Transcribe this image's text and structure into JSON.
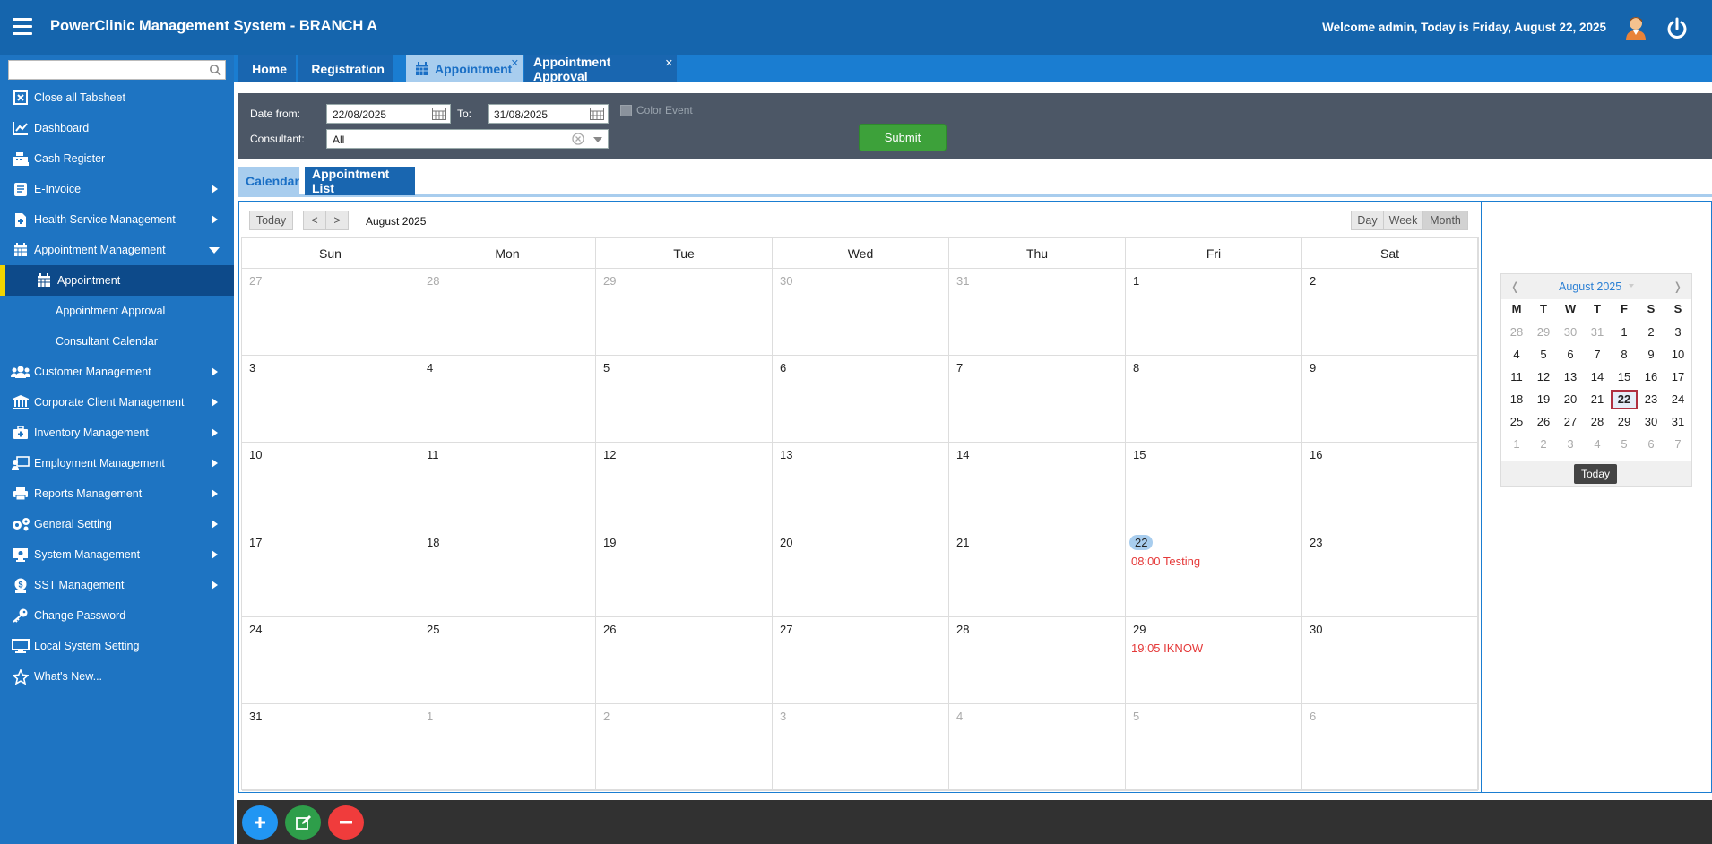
{
  "header": {
    "title": "PowerClinic Management System - BRANCH A",
    "welcome": "Welcome admin, Today is Friday, August 22, 2025"
  },
  "sidebar": {
    "search": {
      "placeholder": ""
    },
    "items": [
      {
        "label": "Close all Tabsheet",
        "icon": "close-box-icon",
        "submenu": false
      },
      {
        "label": "Dashboard",
        "icon": "chart-icon",
        "submenu": false
      },
      {
        "label": "Cash Register",
        "icon": "cash-register-icon",
        "submenu": false
      },
      {
        "label": "E-Invoice",
        "icon": "invoice-icon",
        "submenu": true
      },
      {
        "label": "Health Service Management",
        "icon": "file-plus-icon",
        "submenu": true
      },
      {
        "label": "Appointment Management",
        "icon": "calendar-icon",
        "submenu": true,
        "expanded": true
      },
      {
        "label": "Appointment",
        "icon": "calendar-icon",
        "active": true
      },
      {
        "label": "Appointment Approval",
        "sub": true
      },
      {
        "label": "Consultant Calendar",
        "sub": true
      },
      {
        "label": "Customer Management",
        "icon": "users-icon",
        "submenu": true
      },
      {
        "label": "Corporate Client Management",
        "icon": "bank-icon",
        "submenu": true
      },
      {
        "label": "Inventory Management",
        "icon": "medkit-icon",
        "submenu": true
      },
      {
        "label": "Employment Management",
        "icon": "employee-icon",
        "submenu": true
      },
      {
        "label": "Reports Management",
        "icon": "printer-icon",
        "submenu": true
      },
      {
        "label": "General Setting",
        "icon": "gears-icon",
        "submenu": true
      },
      {
        "label": "System Management",
        "icon": "monitor-settings-icon",
        "submenu": true
      },
      {
        "label": "SST Management",
        "icon": "money-icon",
        "submenu": true
      },
      {
        "label": "Change Password",
        "icon": "key-icon",
        "submenu": false
      },
      {
        "label": "Local System Setting",
        "icon": "desktop-icon",
        "submenu": false
      },
      {
        "label": "What's New...",
        "icon": "star-icon",
        "submenu": false
      }
    ]
  },
  "tabs": [
    {
      "label": "Home",
      "icon": "home-icon"
    },
    {
      "label": "Registration",
      "icon": "users-icon"
    },
    {
      "label": "Appointment",
      "icon": "calendar-icon",
      "active": true,
      "closable": true
    },
    {
      "label": "Appointment Approval",
      "closable": true
    }
  ],
  "filter": {
    "date_from_label": "Date from:",
    "date_from": "22/08/2025",
    "to_label": "To:",
    "date_to": "31/08/2025",
    "color_event_label": "Color Event",
    "consultant_label": "Consultant:",
    "consultant_value": "All",
    "submit_label": "Submit"
  },
  "view_tabs": {
    "calendar": "Calendar",
    "list": "Appointment List"
  },
  "calendar": {
    "today_btn": "Today",
    "prev": "<",
    "next": ">",
    "title": "August 2025",
    "views": [
      "Day",
      "Week",
      "Month"
    ],
    "active_view": "Month",
    "day_headers": [
      "Sun",
      "Mon",
      "Tue",
      "Wed",
      "Thu",
      "Fri",
      "Sat"
    ],
    "weeks": [
      [
        {
          "d": "27",
          "o": true
        },
        {
          "d": "28",
          "o": true
        },
        {
          "d": "29",
          "o": true
        },
        {
          "d": "30",
          "o": true
        },
        {
          "d": "31",
          "o": true
        },
        {
          "d": "1"
        },
        {
          "d": "2"
        }
      ],
      [
        {
          "d": "3"
        },
        {
          "d": "4"
        },
        {
          "d": "5"
        },
        {
          "d": "6"
        },
        {
          "d": "7"
        },
        {
          "d": "8"
        },
        {
          "d": "9"
        }
      ],
      [
        {
          "d": "10"
        },
        {
          "d": "11"
        },
        {
          "d": "12"
        },
        {
          "d": "13"
        },
        {
          "d": "14"
        },
        {
          "d": "15"
        },
        {
          "d": "16"
        }
      ],
      [
        {
          "d": "17"
        },
        {
          "d": "18"
        },
        {
          "d": "19"
        },
        {
          "d": "20"
        },
        {
          "d": "21"
        },
        {
          "d": "22",
          "today": true,
          "event": "08:00 Testing"
        },
        {
          "d": "23"
        }
      ],
      [
        {
          "d": "24"
        },
        {
          "d": "25"
        },
        {
          "d": "26"
        },
        {
          "d": "27"
        },
        {
          "d": "28"
        },
        {
          "d": "29",
          "event": "19:05 IKNOW"
        },
        {
          "d": "30"
        }
      ],
      [
        {
          "d": "31"
        },
        {
          "d": "1",
          "o": true
        },
        {
          "d": "2",
          "o": true
        },
        {
          "d": "3",
          "o": true
        },
        {
          "d": "4",
          "o": true
        },
        {
          "d": "5",
          "o": true
        },
        {
          "d": "6",
          "o": true
        }
      ]
    ],
    "event_color": "#e53a3a"
  },
  "mini_calendar": {
    "title": "August 2025",
    "prev": "❬",
    "next": "❭",
    "headers": [
      "M",
      "T",
      "W",
      "T",
      "F",
      "S",
      "S"
    ],
    "weeks": [
      [
        {
          "d": "28",
          "o": true
        },
        {
          "d": "29",
          "o": true
        },
        {
          "d": "30",
          "o": true
        },
        {
          "d": "31",
          "o": true
        },
        {
          "d": "1"
        },
        {
          "d": "2"
        },
        {
          "d": "3"
        }
      ],
      [
        {
          "d": "4"
        },
        {
          "d": "5"
        },
        {
          "d": "6"
        },
        {
          "d": "7"
        },
        {
          "d": "8"
        },
        {
          "d": "9"
        },
        {
          "d": "10"
        }
      ],
      [
        {
          "d": "11"
        },
        {
          "d": "12"
        },
        {
          "d": "13"
        },
        {
          "d": "14"
        },
        {
          "d": "15"
        },
        {
          "d": "16"
        },
        {
          "d": "17"
        }
      ],
      [
        {
          "d": "18"
        },
        {
          "d": "19"
        },
        {
          "d": "20"
        },
        {
          "d": "21"
        },
        {
          "d": "22",
          "sel": true
        },
        {
          "d": "23"
        },
        {
          "d": "24"
        }
      ],
      [
        {
          "d": "25"
        },
        {
          "d": "26"
        },
        {
          "d": "27"
        },
        {
          "d": "28"
        },
        {
          "d": "29"
        },
        {
          "d": "30"
        },
        {
          "d": "31"
        }
      ],
      [
        {
          "d": "1",
          "o": true
        },
        {
          "d": "2",
          "o": true
        },
        {
          "d": "3",
          "o": true
        },
        {
          "d": "4",
          "o": true
        },
        {
          "d": "5",
          "o": true
        },
        {
          "d": "6",
          "o": true
        },
        {
          "d": "7",
          "o": true
        }
      ]
    ],
    "today_label": "Today"
  },
  "actions": [
    {
      "name": "add-button",
      "icon": "plus-icon",
      "color": "#2196f3"
    },
    {
      "name": "edit-button",
      "icon": "edit-icon",
      "color": "#2e9e4a"
    },
    {
      "name": "delete-button",
      "icon": "minus-icon",
      "color": "#f03c3c"
    }
  ]
}
